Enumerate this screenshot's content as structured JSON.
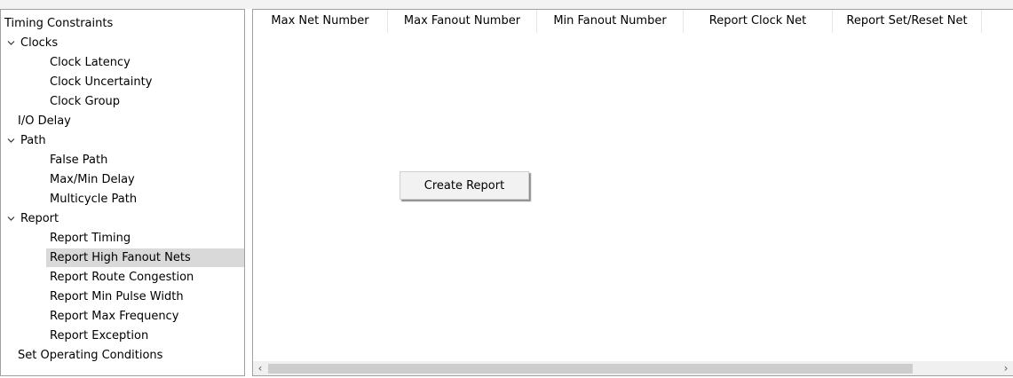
{
  "tree": {
    "items": [
      {
        "label": "Timing Constraints",
        "level": 0,
        "expanded": null,
        "selected": false
      },
      {
        "label": "Clocks",
        "level": 0,
        "expanded": true,
        "selected": false
      },
      {
        "label": "Clock Latency",
        "level": 2,
        "expanded": null,
        "selected": false
      },
      {
        "label": "Clock Uncertainty",
        "level": 2,
        "expanded": null,
        "selected": false
      },
      {
        "label": "Clock Group",
        "level": 2,
        "expanded": null,
        "selected": false
      },
      {
        "label": "I/O Delay",
        "level": 1,
        "expanded": null,
        "selected": false
      },
      {
        "label": "Path",
        "level": 0,
        "expanded": true,
        "selected": false
      },
      {
        "label": "False Path",
        "level": 2,
        "expanded": null,
        "selected": false
      },
      {
        "label": "Max/Min Delay",
        "level": 2,
        "expanded": null,
        "selected": false
      },
      {
        "label": "Multicycle Path",
        "level": 2,
        "expanded": null,
        "selected": false
      },
      {
        "label": "Report",
        "level": 0,
        "expanded": true,
        "selected": false
      },
      {
        "label": "Report Timing",
        "level": 2,
        "expanded": null,
        "selected": false
      },
      {
        "label": "Report High Fanout Nets",
        "level": 2,
        "expanded": null,
        "selected": true
      },
      {
        "label": "Report Route Congestion",
        "level": 2,
        "expanded": null,
        "selected": false
      },
      {
        "label": "Report Min Pulse Width",
        "level": 2,
        "expanded": null,
        "selected": false
      },
      {
        "label": "Report Max Frequency",
        "level": 2,
        "expanded": null,
        "selected": false
      },
      {
        "label": "Report Exception",
        "level": 2,
        "expanded": null,
        "selected": false
      },
      {
        "label": "Set Operating Conditions",
        "level": 1,
        "expanded": null,
        "selected": false
      }
    ]
  },
  "table": {
    "columns": [
      "Max Net Number",
      "Max Fanout Number",
      "Min Fanout Number",
      "Report Clock Net",
      "Report Set/Reset Net"
    ]
  },
  "create_button_label": "Create Report",
  "scrollbar": {
    "left_arrow": "‹",
    "right_arrow": "›"
  }
}
